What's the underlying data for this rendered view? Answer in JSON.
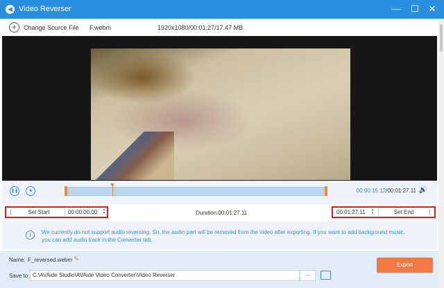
{
  "window": {
    "title": "Video Reverser",
    "minimize_glyph": "—",
    "restore_glyph": "☐",
    "close_glyph": "✕"
  },
  "info": {
    "change_source": "Change Source File",
    "file_name": "F.webm",
    "file_meta": "1920x1080/00:01:27/17.47 MB"
  },
  "player": {
    "current_time": "00:00:15.12",
    "total_time": "/00:01:27.11",
    "playhead_fraction": 0.178
  },
  "trim": {
    "set_start_label": "Set Start",
    "start_value": "00:00:00.00",
    "duration": "Duration:00:01:27.11",
    "end_value": "00:01:27.11",
    "set_end_label": "Set End"
  },
  "notice": {
    "message": "We currently do not support audio reversing. So, the audio part will be removed from the video after exporting. If you want to add background music, you can add audio track in the Converter tab."
  },
  "output": {
    "name_label": "Name:",
    "name_value": "F_reversed.webm",
    "save_label": "Save to:",
    "save_path": "C:\\AVAide Studio\\AVAide Video Converter\\Video Reverser",
    "browse": "···",
    "export_label": "Export"
  },
  "colors": {
    "accent": "#2b8fe0",
    "export": "#f07a45",
    "highlight_border": "#e31d1d",
    "trim_handle": "#f08a3a"
  },
  "icons": [
    "app-icon",
    "minimize-icon",
    "restore-icon",
    "close-icon",
    "add-file-icon",
    "play-pause-icon",
    "stop-icon",
    "volume-icon",
    "info-icon",
    "pencil-icon",
    "folder-icon"
  ]
}
